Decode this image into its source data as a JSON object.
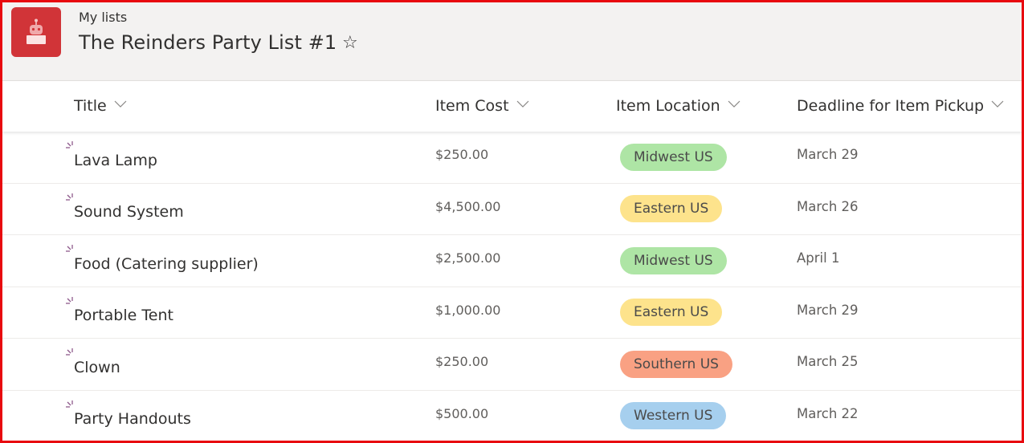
{
  "header": {
    "breadcrumb": "My lists",
    "title": "The Reinders Party List #1",
    "favorite_icon": "star-outline-icon",
    "list_icon": "robot-icon",
    "list_icon_color": "#d13438"
  },
  "columns": [
    {
      "label": "Title"
    },
    {
      "label": "Item Cost"
    },
    {
      "label": "Item Location"
    },
    {
      "label": "Deadline for Item Pickup"
    }
  ],
  "location_colors": {
    "Midwest US": "#aee5a5",
    "Eastern US": "#fde38c",
    "Southern US": "#f9a183",
    "Western US": "#a6cfee"
  },
  "rows": [
    {
      "title": "Lava Lamp",
      "cost": "$250.00",
      "location": "Midwest US",
      "deadline": "March 29",
      "is_new": true
    },
    {
      "title": "Sound System",
      "cost": "$4,500.00",
      "location": "Eastern US",
      "deadline": "March 26",
      "is_new": true
    },
    {
      "title": "Food (Catering supplier)",
      "cost": "$2,500.00",
      "location": "Midwest US",
      "deadline": "April 1",
      "is_new": true
    },
    {
      "title": "Portable Tent",
      "cost": "$1,000.00",
      "location": "Eastern US",
      "deadline": "March 29",
      "is_new": true
    },
    {
      "title": "Clown",
      "cost": "$250.00",
      "location": "Southern US",
      "deadline": "March 25",
      "is_new": true
    },
    {
      "title": "Party Handouts",
      "cost": "$500.00",
      "location": "Western US",
      "deadline": "March 22",
      "is_new": true
    }
  ]
}
